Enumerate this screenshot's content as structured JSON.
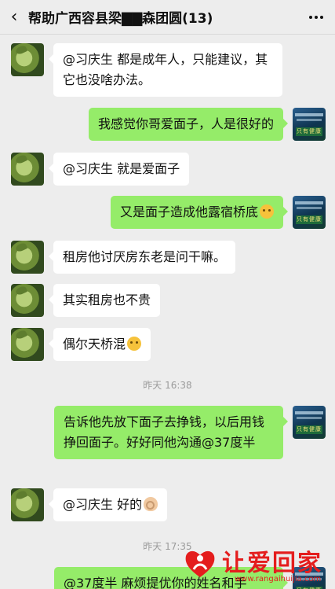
{
  "header": {
    "title": "帮助广西容县梁▇▇森团圆(13)",
    "back_icon": "chevron-left-icon",
    "more_icon": "more-dots-icon"
  },
  "messages": [
    {
      "side": "left",
      "text": "@习庆生  都是成年人，只能建议，其它也没啥办法。"
    },
    {
      "side": "right",
      "text": "我感觉你哥爱面子，人是很好的"
    },
    {
      "side": "left",
      "text": "@习庆生  就是爱面子"
    },
    {
      "side": "right",
      "text": "又是面子造成他露宿桥底",
      "emoji": "thinking-face"
    },
    {
      "side": "left",
      "text": "租房他讨厌房东老是问干嘛。"
    },
    {
      "side": "left",
      "text": "其实租房也不贵"
    },
    {
      "side": "left",
      "text": "偶尔天桥混",
      "emoji": "thinking-face"
    },
    {
      "side": "right",
      "text": "告诉他先放下面子去挣钱，以后用钱挣回面子。好好同他沟通@37度半"
    },
    {
      "side": "left",
      "text": "@习庆生  好的",
      "emoji": "ok-hand"
    },
    {
      "side": "right",
      "text": "@37度半  麻烦提优你的姓名和手"
    }
  ],
  "timestamps": [
    "昨天 16:38",
    "昨天 17:35"
  ],
  "avatar_badge": "只有健康",
  "watermark": {
    "text": "让爱回家",
    "url": "www.rangaihuijia.com",
    "color": "#e41d1d"
  },
  "colors": {
    "background": "#ededed",
    "my_bubble": "#95ec69",
    "other_bubble": "#ffffff"
  }
}
